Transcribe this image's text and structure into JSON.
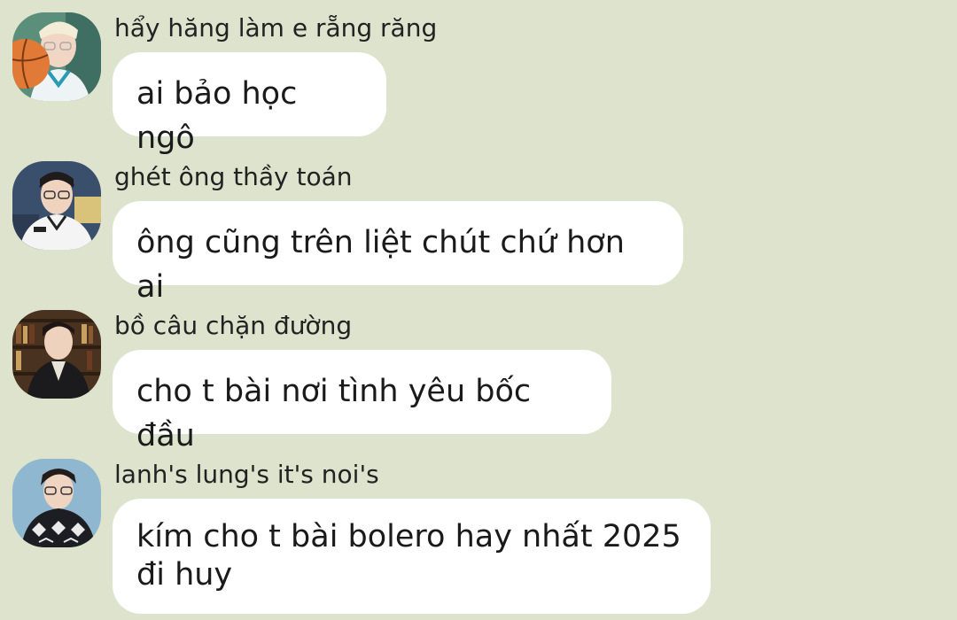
{
  "messages": [
    {
      "sender": "hẩy hăng làm e rẵng răng",
      "text": "ai bảo học ngô",
      "avatar": "avatar-basketball-player-icon"
    },
    {
      "sender": "ghét ông thầy toán",
      "text": "ông cũng trên liệt chút chứ hơn ai",
      "avatar": "avatar-glasses-person-icon"
    },
    {
      "sender": "bồ câu chặn đường",
      "text": "cho t bài nơi tình yêu bốc đầu",
      "avatar": "avatar-library-person-icon"
    },
    {
      "sender": "lanh's lung's it's noi's",
      "text_line1": "kím cho t bài bolero hay nhất 2025",
      "text_line2": "đi huy",
      "avatar": "avatar-sweater-person-icon"
    }
  ],
  "colors": {
    "background": "#dde3cd",
    "bubble": "#ffffff",
    "text": "#1a1a1a"
  }
}
